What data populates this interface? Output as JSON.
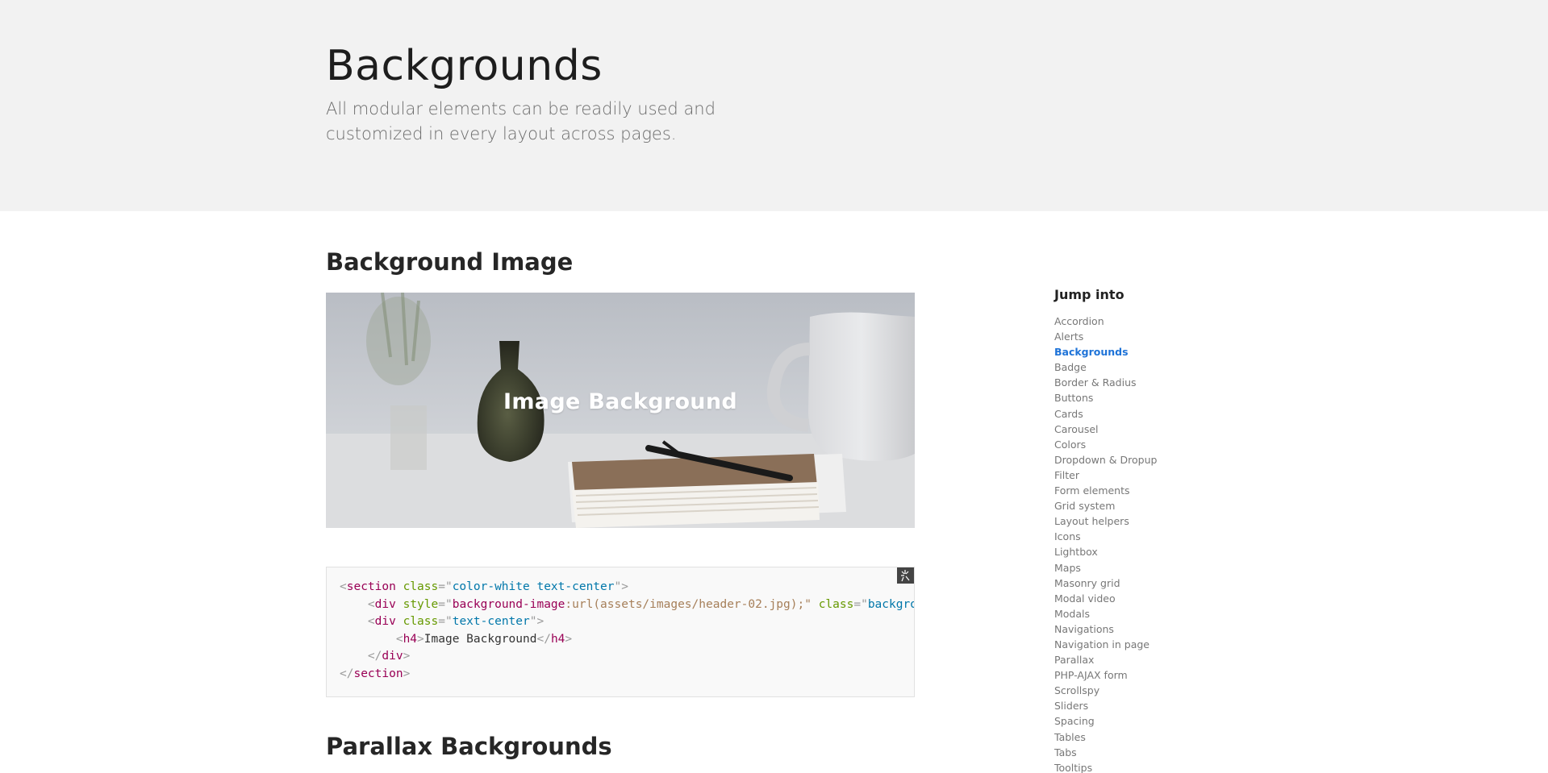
{
  "hero": {
    "title": "Backgrounds",
    "subtitle": "All modular elements can be readily used and customized in every layout across pages."
  },
  "sections": {
    "image": {
      "title": "Background Image",
      "caption": "Image Background"
    },
    "parallax": {
      "title": "Parallax Backgrounds"
    }
  },
  "code": {
    "line1": {
      "open": "<",
      "tag": "section",
      "attr": "class",
      "eq": "=\"",
      "val": "color-white text-center",
      "close": "\">"
    },
    "line2": {
      "indent": "    ",
      "open": "<",
      "tag": "div",
      "attr": "style",
      "eq": "=\"",
      "prop": "background-image",
      "propval": ":url(assets/images/header-02.jpg);\" ",
      "attr2": "class",
      "eq2": "=\"",
      "val2": "background-full\""
    },
    "line3": {
      "indent": "    ",
      "open": "<",
      "tag": "div",
      "attr": "class",
      "eq": "=\"",
      "val": "text-center",
      "close": "\">"
    },
    "line4": {
      "indent": "        ",
      "open": "<",
      "tag": "h4",
      "gt": ">",
      "text": "Image Background",
      "endopen": "</",
      "endtag": "h4",
      "endgt": ">"
    },
    "line5": {
      "indent": "    ",
      "open": "</",
      "tag": "div",
      "close": ">"
    },
    "line6": {
      "open": "</",
      "tag": "section",
      "close": ">"
    }
  },
  "copy_icon": "clipboard-icon",
  "sidebar": {
    "title": "Jump into",
    "items": [
      {
        "label": "Accordion",
        "active": false
      },
      {
        "label": "Alerts",
        "active": false
      },
      {
        "label": "Backgrounds",
        "active": true
      },
      {
        "label": "Badge",
        "active": false
      },
      {
        "label": "Border & Radius",
        "active": false
      },
      {
        "label": "Buttons",
        "active": false
      },
      {
        "label": "Cards",
        "active": false
      },
      {
        "label": "Carousel",
        "active": false
      },
      {
        "label": "Colors",
        "active": false
      },
      {
        "label": "Dropdown & Dropup",
        "active": false
      },
      {
        "label": "Filter",
        "active": false
      },
      {
        "label": "Form elements",
        "active": false
      },
      {
        "label": "Grid system",
        "active": false
      },
      {
        "label": "Layout helpers",
        "active": false
      },
      {
        "label": "Icons",
        "active": false
      },
      {
        "label": "Lightbox",
        "active": false
      },
      {
        "label": "Maps",
        "active": false
      },
      {
        "label": "Masonry grid",
        "active": false
      },
      {
        "label": "Modal video",
        "active": false
      },
      {
        "label": "Modals",
        "active": false
      },
      {
        "label": "Navigations",
        "active": false
      },
      {
        "label": "Navigation in page",
        "active": false
      },
      {
        "label": "Parallax",
        "active": false
      },
      {
        "label": "PHP-AJAX form",
        "active": false
      },
      {
        "label": "Scrollspy",
        "active": false
      },
      {
        "label": "Sliders",
        "active": false
      },
      {
        "label": "Spacing",
        "active": false
      },
      {
        "label": "Tables",
        "active": false
      },
      {
        "label": "Tabs",
        "active": false
      },
      {
        "label": "Tooltips",
        "active": false
      }
    ]
  }
}
